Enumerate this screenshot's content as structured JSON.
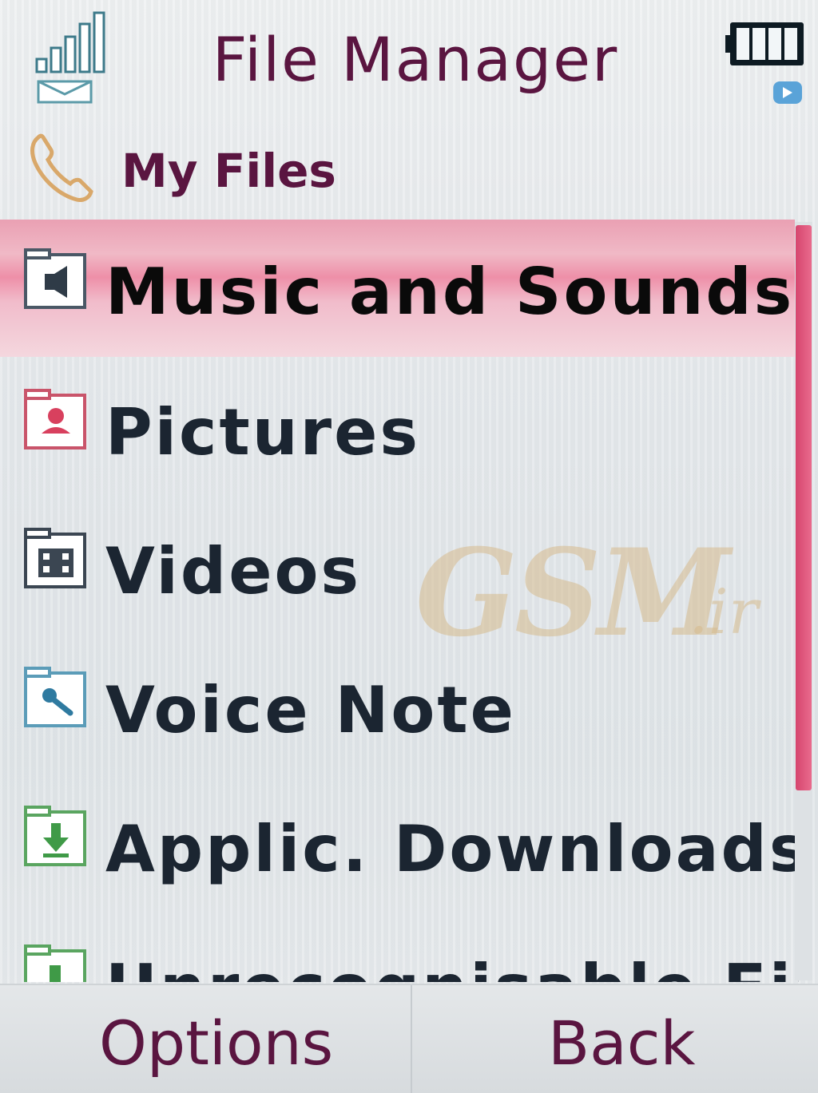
{
  "status_bar": {
    "signal_icon": "signal-strength-icon",
    "battery_icon": "battery-icon"
  },
  "header": {
    "title": "File Manager"
  },
  "breadcrumb": {
    "icon": "phone-icon",
    "label": "My Files"
  },
  "list": {
    "items": [
      {
        "label": "Music and Sounds",
        "icon": "music-folder-icon",
        "selected": true
      },
      {
        "label": "Pictures",
        "icon": "pictures-folder-icon",
        "selected": false
      },
      {
        "label": "Videos",
        "icon": "videos-folder-icon",
        "selected": false
      },
      {
        "label": "Voice Note",
        "icon": "voice-note-folder-icon",
        "selected": false
      },
      {
        "label": "Applic. Downloads",
        "icon": "downloads-folder-icon",
        "selected": false
      },
      {
        "label": "Unrecognisable Fil",
        "icon": "unrecognised-folder-icon",
        "selected": false
      }
    ]
  },
  "watermark": {
    "text": "GSM",
    "suffix": ".ir"
  },
  "softkeys": {
    "left": "Options",
    "right": "Back"
  },
  "colors": {
    "accent": "#e0567c",
    "title_text": "#5a1540",
    "item_text": "#1b2531"
  }
}
